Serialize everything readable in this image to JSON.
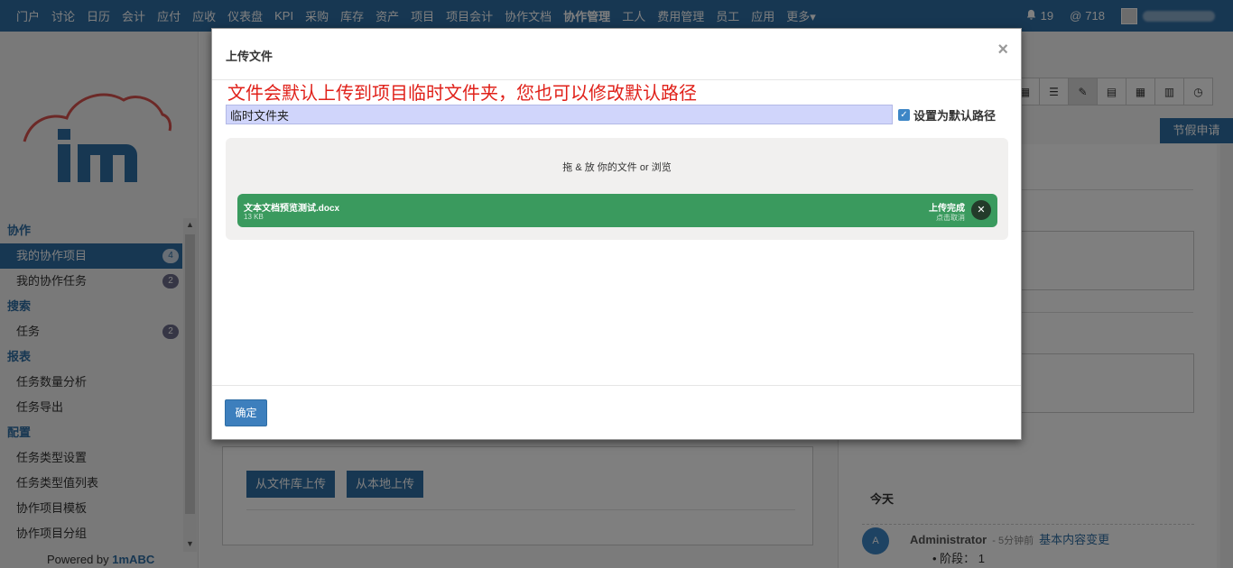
{
  "nav": {
    "items": [
      "门户",
      "讨论",
      "日历",
      "会计",
      "应付",
      "应收",
      "仪表盘",
      "KPI",
      "采购",
      "库存",
      "资产",
      "项目",
      "项目会计",
      "协作文档",
      "协作管理",
      "工人",
      "费用管理",
      "员工",
      "应用",
      "更多▾"
    ],
    "active_index": 14,
    "notifications": "19",
    "mentions": "718"
  },
  "sidebar": {
    "sections": [
      {
        "head": "协作",
        "items": [
          {
            "label": "我的协作项目",
            "badge": "4",
            "active": true
          },
          {
            "label": "我的协作任务",
            "badge": "2"
          }
        ]
      },
      {
        "head": "搜索",
        "items": [
          {
            "label": "任务",
            "badge": "2"
          }
        ]
      },
      {
        "head": "报表",
        "items": [
          {
            "label": "任务数量分析"
          },
          {
            "label": "任务导出"
          }
        ]
      },
      {
        "head": "配置",
        "items": [
          {
            "label": "任务类型设置"
          },
          {
            "label": "任务类型值列表"
          },
          {
            "label": "协作项目模板"
          },
          {
            "label": "协作项目分组"
          }
        ]
      }
    ],
    "powered_prefix": "Powered by ",
    "powered_brand": "1mABC"
  },
  "background": {
    "leave_button": "节假申请",
    "upload_from_library": "从文件库上传",
    "upload_from_local": "从本地上传",
    "today": "今天",
    "activity": {
      "avatar": "A",
      "who": "Administrator",
      "when": "- 5分钟前",
      "what": "基本内容变更",
      "detail": "• 阶段：  1"
    }
  },
  "modal": {
    "title": "上传文件",
    "close": "×",
    "notice": "文件会默认上传到项目临时文件夹，您也可以修改默认路径",
    "path_value": "临时文件夹",
    "default_checkbox_label": "设置为默认路径",
    "default_checked": true,
    "dropzone_text_prefix": "拖 & 放 你的文件 or ",
    "dropzone_browse": "浏览",
    "file": {
      "name": "文本文档预览测试.docx",
      "size": "13 KB",
      "status": "上传完成",
      "cancel": "点击取消"
    },
    "ok_button": "确定"
  }
}
